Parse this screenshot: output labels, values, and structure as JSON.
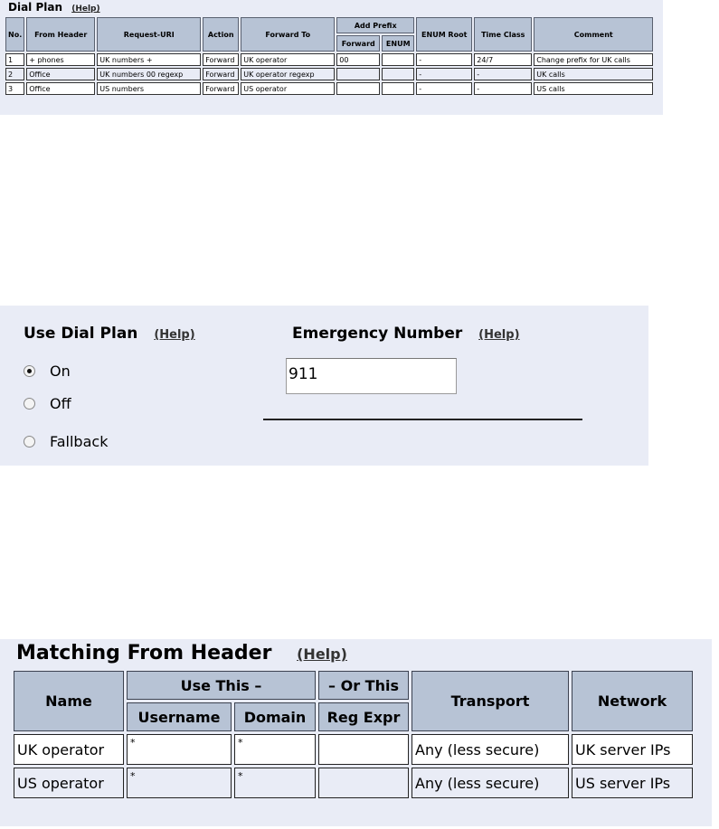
{
  "dial_plan": {
    "title": "Dial Plan",
    "help": "(Help)",
    "headers": {
      "no": "No.",
      "from": "From Header",
      "uri": "Request-URI",
      "action": "Action",
      "forward_to": "Forward To",
      "add_prefix": "Add Prefix",
      "forward": "Forward",
      "enum": "ENUM",
      "enum_root": "ENUM Root",
      "time_class": "Time Class",
      "comment": "Comment"
    },
    "rows": [
      {
        "no": "1",
        "from": "+ phones",
        "uri": "UK numbers +",
        "action": "Forward",
        "fwd": "UK operator",
        "prefix": "00",
        "enum": "",
        "root": "-",
        "time": "24/7",
        "comment": "Change prefix for UK calls"
      },
      {
        "no": "2",
        "from": "Office",
        "uri": "UK numbers 00 regexp",
        "action": "Forward",
        "fwd": "UK operator regexp",
        "prefix": "",
        "enum": "",
        "root": "-",
        "time": "-",
        "comment": "UK calls"
      },
      {
        "no": "3",
        "from": "Office",
        "uri": "US numbers",
        "action": "Forward",
        "fwd": "US operator",
        "prefix": "",
        "enum": "",
        "root": "-",
        "time": "-",
        "comment": "US calls"
      }
    ]
  },
  "settings": {
    "use_dial_plan": {
      "label": "Use Dial Plan",
      "help": "(Help)",
      "options": [
        "On",
        "Off",
        "Fallback"
      ],
      "selected": "On"
    },
    "emergency": {
      "label": "Emergency Number",
      "help": "(Help)",
      "value": "911"
    }
  },
  "matching_from_header": {
    "title": "Matching From Header",
    "help": "(Help)",
    "headers": {
      "name": "Name",
      "use_this": "Use This –",
      "or_this": "– Or This",
      "transport": "Transport",
      "network": "Network",
      "username": "Username",
      "domain": "Domain",
      "reg_expr": "Reg Expr"
    },
    "rows": [
      {
        "name": "UK operator",
        "username": "*",
        "domain": "*",
        "regexp": "",
        "transport": "Any (less secure)",
        "network": "UK server IPs"
      },
      {
        "name": "US operator",
        "username": "*",
        "domain": "*",
        "regexp": "",
        "transport": "Any (less secure)",
        "network": "US server IPs"
      }
    ]
  }
}
